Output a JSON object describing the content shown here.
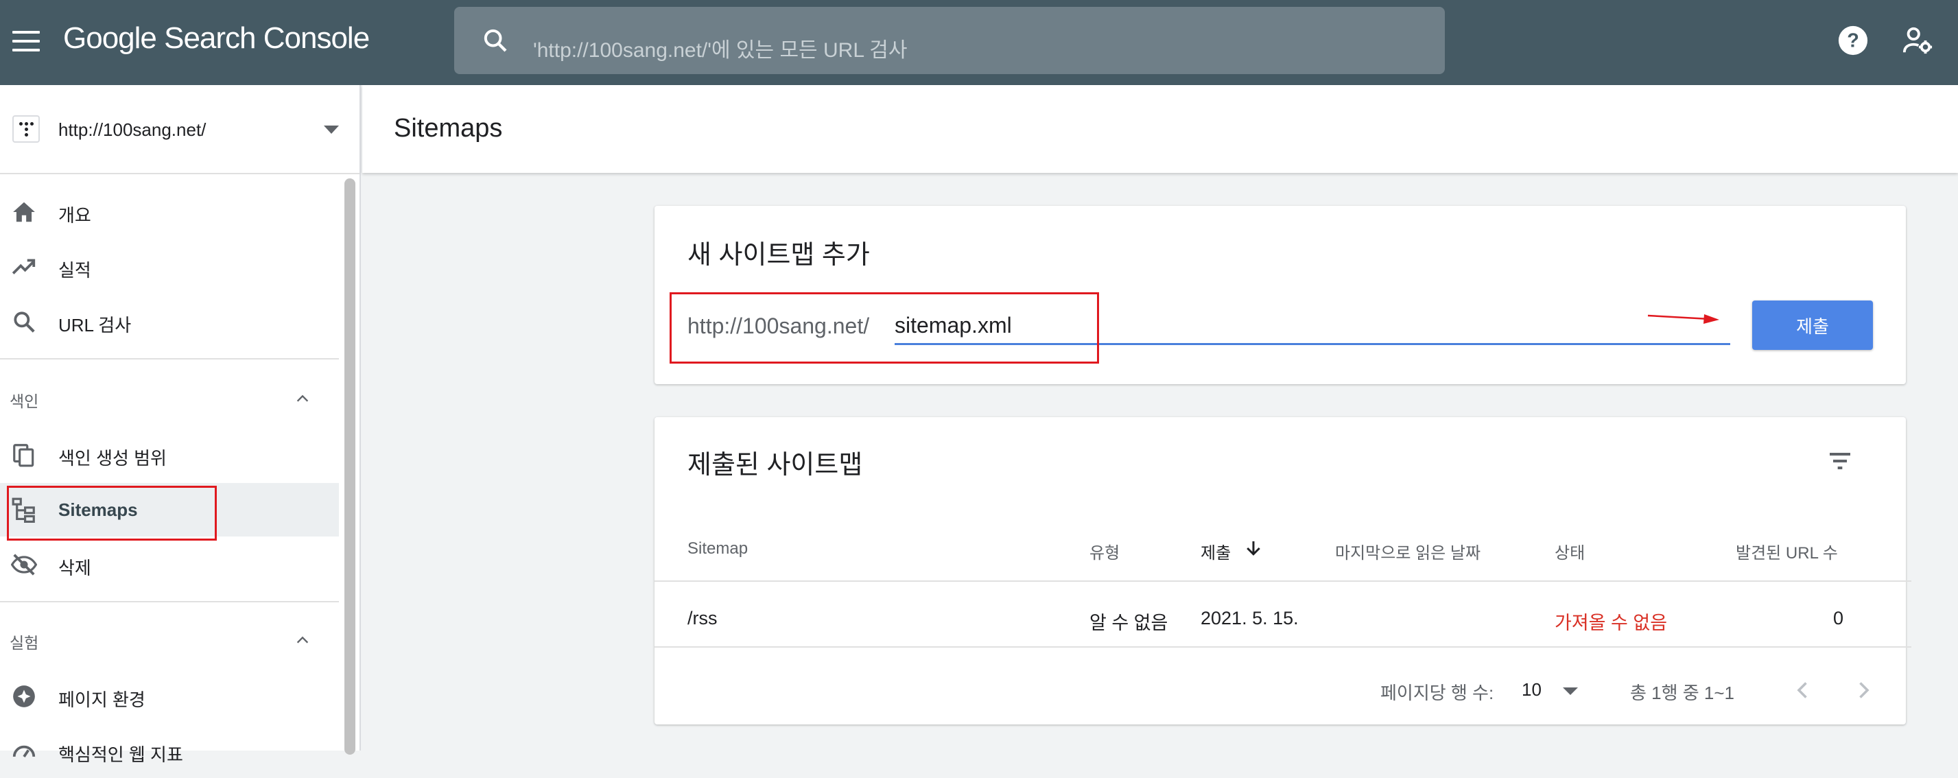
{
  "app": {
    "logo": "Google Search Console"
  },
  "search": {
    "placeholder": "'http://100sang.net/'에 있는 모든 URL 검사"
  },
  "property": {
    "name": "http://100sang.net/"
  },
  "sidebar": {
    "items_top": [
      {
        "label": "개요",
        "icon": "home-icon"
      },
      {
        "label": "실적",
        "icon": "trending-up-icon"
      },
      {
        "label": "URL 검사",
        "icon": "search-icon"
      }
    ],
    "section_index": {
      "label": "색인"
    },
    "items_index": [
      {
        "label": "색인 생성 범위",
        "icon": "copy-icon"
      },
      {
        "label": "Sitemaps",
        "icon": "sitemap-icon"
      },
      {
        "label": "삭제",
        "icon": "eye-off-icon"
      }
    ],
    "section_experience": {
      "label": "실험"
    },
    "items_experience": [
      {
        "label": "페이지 환경",
        "icon": "plus-circle-icon"
      },
      {
        "label": "핵심적인 웹 지표",
        "icon": "gauge-icon"
      }
    ]
  },
  "page": {
    "title": "Sitemaps"
  },
  "add_card": {
    "title": "새 사이트맵 추가",
    "url_prefix": "http://100sang.net/",
    "input_value": "sitemap.xml",
    "submit_label": "제출"
  },
  "submitted_card": {
    "title": "제출된 사이트맵",
    "columns": [
      "Sitemap",
      "유형",
      "제출",
      "마지막으로 읽은 날짜",
      "상태",
      "발견된 URL 수"
    ],
    "rows": [
      {
        "sitemap": "/rss",
        "type": "알 수 없음",
        "submitted": "2021. 5. 15.",
        "last_read": "",
        "status": "가져올 수 없음",
        "urls": "0"
      }
    ],
    "rows_per_page_label": "페이지당 행 수:",
    "rows_per_page_value": "10",
    "range_text": "총 1행 중 1~1"
  },
  "colors": {
    "topbar": "#455a64",
    "accent": "#4d85e6",
    "error": "#d93025",
    "highlight": "#e0191f"
  }
}
